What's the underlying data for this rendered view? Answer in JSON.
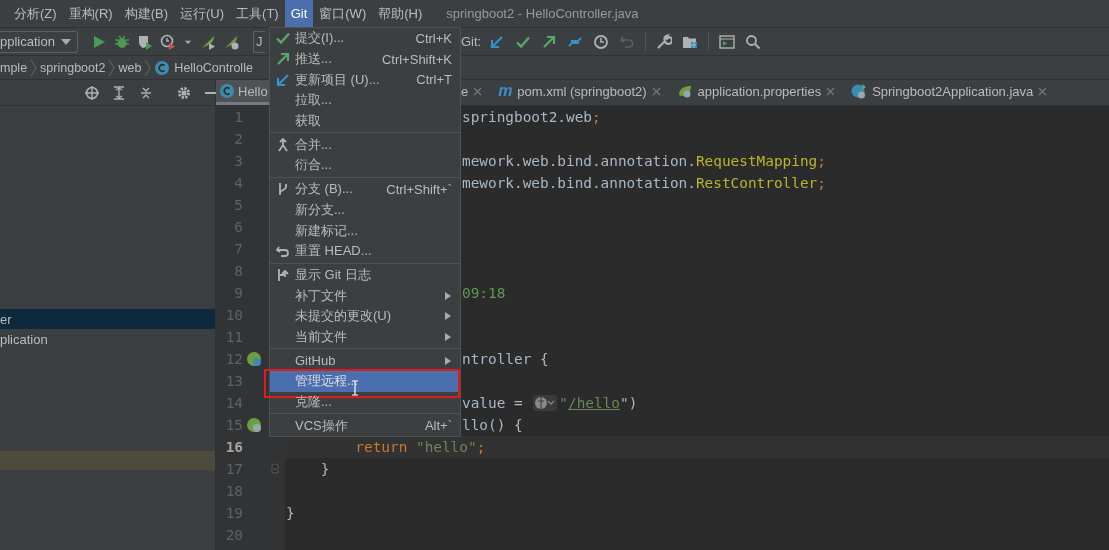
{
  "menubar": {
    "items": [
      {
        "label": "分析(Z)",
        "selected": false
      },
      {
        "label": "重构(R)",
        "selected": false
      },
      {
        "label": "构建(B)",
        "selected": false
      },
      {
        "label": "运行(U)",
        "selected": false
      },
      {
        "label": "工具(T)",
        "selected": false
      },
      {
        "label": "Git",
        "selected": true
      },
      {
        "label": "窗口(W)",
        "selected": false
      },
      {
        "label": "帮助(H)",
        "selected": false
      }
    ],
    "title": "springboot2 - HelloController.java"
  },
  "toolbar": {
    "run_config": "pplication",
    "field_text": "J",
    "git_label": "Git:"
  },
  "breadcrumbs": [
    {
      "label": "mple",
      "kind": "folder"
    },
    {
      "label": "springboot2",
      "kind": "folder"
    },
    {
      "label": "web",
      "kind": "folder"
    },
    {
      "label": "HelloControlle",
      "kind": "class"
    }
  ],
  "project_panel": {
    "rows": [
      {
        "label": "er",
        "selected": true
      },
      {
        "label": "plication",
        "selected": false
      }
    ]
  },
  "editor": {
    "tabs": [
      {
        "label": "Hello",
        "selected": true
      },
      {
        "label": "e",
        "selected": false
      },
      {
        "label": "pom.xml (springboot2)",
        "selected": false,
        "glyph": "m"
      },
      {
        "label": "application.properties",
        "selected": false
      },
      {
        "label": "Springboot2Application.java",
        "selected": false
      }
    ],
    "lines": [
      {
        "number": "1",
        "covered": true,
        "tokens": [
          {
            "text": "springboot2.web",
            "kind": "plain"
          },
          {
            "text": ";",
            "kind": "keyword"
          }
        ]
      },
      {
        "number": "2"
      },
      {
        "number": "3",
        "covered": true,
        "tokens": [
          {
            "text": "mework.web.bind.annotation.",
            "kind": "plain"
          },
          {
            "text": "RequestMapping",
            "kind": "class"
          },
          {
            "text": ";",
            "kind": "keyword"
          }
        ]
      },
      {
        "number": "4",
        "covered": true,
        "tokens": [
          {
            "text": "mework.web.bind.annotation.",
            "kind": "plain"
          },
          {
            "text": "RestController",
            "kind": "class"
          },
          {
            "text": ";",
            "kind": "keyword"
          }
        ]
      },
      {
        "number": "5"
      },
      {
        "number": "6"
      },
      {
        "number": "7"
      },
      {
        "number": "8"
      },
      {
        "number": "9",
        "covered": true,
        "tokens": [
          {
            "text": "09:18",
            "kind": "doc"
          }
        ]
      },
      {
        "number": "10"
      },
      {
        "number": "11"
      },
      {
        "number": "12",
        "covered": true,
        "tokens": [
          {
            "text": "ntroller {",
            "kind": "plain"
          }
        ]
      },
      {
        "number": "13"
      },
      {
        "number": "14",
        "covered": true,
        "tokens": [
          {
            "text": "value = ",
            "kind": "plain"
          },
          {
            "kind": "globe"
          },
          {
            "text": "\"",
            "kind": "string"
          },
          {
            "text": "/hello",
            "kind": "link"
          },
          {
            "text": "\")",
            "kind": "plain"
          }
        ]
      },
      {
        "number": "15",
        "covered": true,
        "tokens": [
          {
            "text": "llo() {",
            "kind": "plain"
          }
        ]
      },
      {
        "number": "16",
        "current": true,
        "tokens": [
          {
            "text": "        return ",
            "kind": "keyword"
          },
          {
            "text": "\"hello\"",
            "kind": "string"
          },
          {
            "text": ";",
            "kind": "keyword"
          }
        ]
      },
      {
        "number": "17",
        "tokens": [
          {
            "text": "    }",
            "kind": "plain"
          }
        ]
      },
      {
        "number": "18"
      },
      {
        "number": "19",
        "tokens": [
          {
            "text": "}",
            "kind": "plain"
          }
        ]
      },
      {
        "number": "20"
      }
    ]
  },
  "git_menu": {
    "items": [
      {
        "kind": "item",
        "label": "提交(I)...",
        "shortcut": "Ctrl+K",
        "selected": false
      },
      {
        "kind": "item",
        "label": "推送...",
        "shortcut": "Ctrl+Shift+K",
        "selected": false
      },
      {
        "kind": "item",
        "label": "更新项目 (U)...",
        "shortcut": "Ctrl+T",
        "selected": false
      },
      {
        "kind": "item",
        "label": "拉取...",
        "selected": false
      },
      {
        "kind": "item",
        "label": "获取",
        "selected": false
      },
      {
        "kind": "separator"
      },
      {
        "kind": "item",
        "label": "合并...",
        "selected": false
      },
      {
        "kind": "item",
        "label": "衍合...",
        "selected": false
      },
      {
        "kind": "separator"
      },
      {
        "kind": "item",
        "label": "分支 (B)...",
        "shortcut": "Ctrl+Shift+`",
        "selected": false
      },
      {
        "kind": "item",
        "label": "新分支...",
        "selected": false
      },
      {
        "kind": "item",
        "label": "新建标记...",
        "selected": false
      },
      {
        "kind": "item",
        "label": "重置 HEAD...",
        "selected": false
      },
      {
        "kind": "separator"
      },
      {
        "kind": "item",
        "label": "显示 Git 日志",
        "selected": false
      },
      {
        "kind": "item",
        "label": "补丁文件",
        "submenu": true,
        "selected": false
      },
      {
        "kind": "item",
        "label": "未提交的更改(U)",
        "submenu": true,
        "selected": false
      },
      {
        "kind": "item",
        "label": "当前文件",
        "submenu": true,
        "selected": false
      },
      {
        "kind": "separator"
      },
      {
        "kind": "item",
        "label": "GitHub",
        "submenu": true,
        "selected": false
      },
      {
        "kind": "item",
        "label": "管理远程...",
        "selected": true,
        "outlined": true
      },
      {
        "kind": "item",
        "label": "克隆...",
        "selected": false
      },
      {
        "kind": "separator"
      },
      {
        "kind": "item",
        "label": "VCS操作",
        "shortcut": "Alt+`",
        "selected": false
      }
    ]
  }
}
